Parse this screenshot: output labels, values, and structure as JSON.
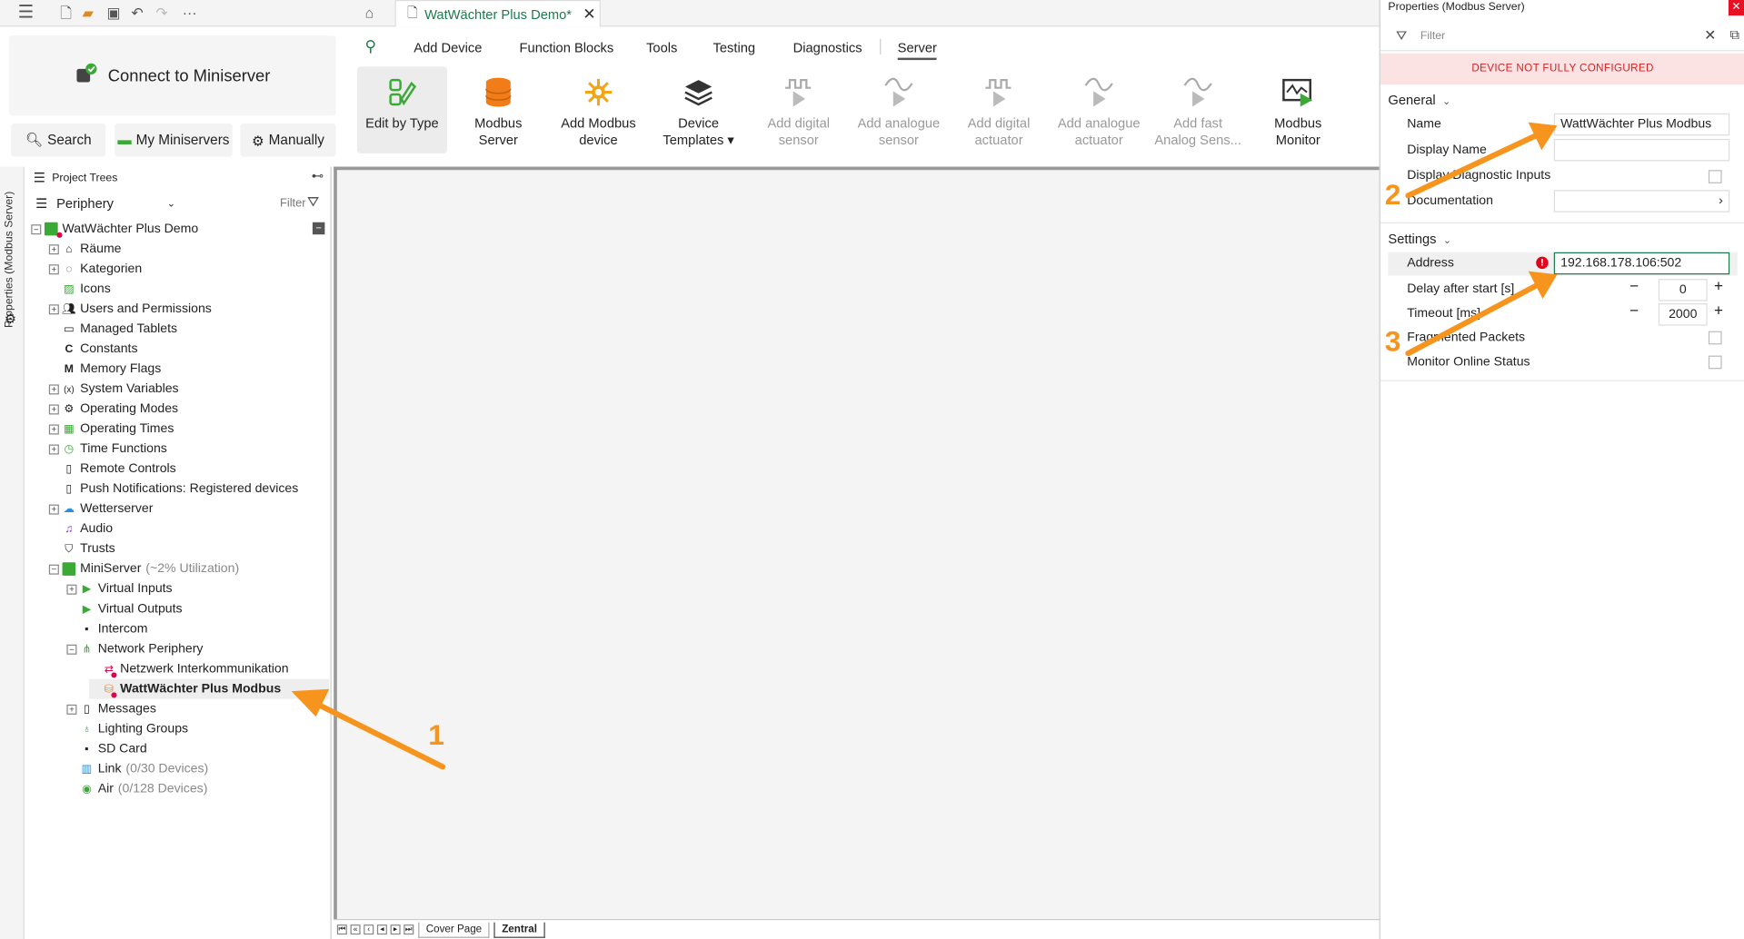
{
  "tab": {
    "title": "WatWächter Plus Demo*"
  },
  "connect": {
    "label": "Connect to Miniserver"
  },
  "side_buttons": {
    "search": "Search",
    "my_miniservers": "My Miniservers",
    "manually": "Manually"
  },
  "vertical_strip": {
    "label": "Properties (Modbus Server)"
  },
  "tree": {
    "header": "Project Trees",
    "selector": "Periphery",
    "filter_label": "Filter",
    "items": [
      {
        "label": "WatWächter Plus Demo"
      },
      {
        "label": "Räume"
      },
      {
        "label": "Kategorien"
      },
      {
        "label": "Icons"
      },
      {
        "label": "Users and Permissions"
      },
      {
        "label": "Managed Tablets"
      },
      {
        "label": "Constants"
      },
      {
        "label": "Memory Flags"
      },
      {
        "label": "System Variables"
      },
      {
        "label": "Operating Modes"
      },
      {
        "label": "Operating Times"
      },
      {
        "label": "Time Functions"
      },
      {
        "label": "Remote Controls"
      },
      {
        "label": "Push Notifications: Registered devices"
      },
      {
        "label": "Wetterserver"
      },
      {
        "label": "Audio"
      },
      {
        "label": "Trusts"
      },
      {
        "label": "MiniServer",
        "extra": "(~2% Utilization)"
      },
      {
        "label": "Virtual Inputs"
      },
      {
        "label": "Virtual Outputs"
      },
      {
        "label": "Intercom"
      },
      {
        "label": "Network Periphery"
      },
      {
        "label": "Netzwerk Interkommunikation"
      },
      {
        "label": "WattWächter Plus Modbus"
      },
      {
        "label": "Messages"
      },
      {
        "label": "Lighting Groups"
      },
      {
        "label": "SD Card"
      },
      {
        "label": "Link",
        "extra": "(0/30 Devices)"
      },
      {
        "label": "Air",
        "extra": "(0/128 Devices)"
      }
    ]
  },
  "ribbon": {
    "tabs": [
      "Add Device",
      "Function Blocks",
      "Tools",
      "Testing",
      "Diagnostics",
      "Server"
    ],
    "buttons": [
      {
        "line1": "Edit by Type",
        "line2": ""
      },
      {
        "line1": "Modbus",
        "line2": "Server"
      },
      {
        "line1": "Add Modbus",
        "line2": "device"
      },
      {
        "line1": "Device",
        "line2": "Templates ▾"
      },
      {
        "line1": "Add digital",
        "line2": "sensor"
      },
      {
        "line1": "Add analogue",
        "line2": "sensor"
      },
      {
        "line1": "Add digital",
        "line2": "actuator"
      },
      {
        "line1": "Add analogue",
        "line2": "actuator"
      },
      {
        "line1": "Add fast",
        "line2": "Analog Sens..."
      },
      {
        "line1": "Modbus",
        "line2": "Monitor"
      }
    ]
  },
  "sheets": {
    "cover": "Cover Page",
    "zentral": "Zentral"
  },
  "props": {
    "title": "Properties (Modbus Server)",
    "filter_placeholder": "Filter",
    "warning": "DEVICE NOT FULLY CONFIGURED",
    "general": {
      "heading": "General",
      "name_label": "Name",
      "name_value": "WattWächter Plus Modbus",
      "display_name_label": "Display Name",
      "display_name_value": "",
      "diag_label": "Display Diagnostic Inputs",
      "doc_label": "Documentation"
    },
    "settings": {
      "heading": "Settings",
      "address_label": "Address",
      "address_value": "192.168.178.106:502",
      "delay_label": "Delay after start [s]",
      "delay_value": "0",
      "timeout_label": "Timeout [ms]",
      "timeout_value": "2000",
      "fragmented_label": "Fragmented Packets",
      "monitor_label": "Monitor Online Status"
    }
  },
  "annotations": {
    "one": "1",
    "two": "2",
    "three": "3"
  },
  "colors": {
    "accent_green": "#1d7a4e",
    "annotation_orange": "#f7941d",
    "warning_red": "#d52222"
  }
}
